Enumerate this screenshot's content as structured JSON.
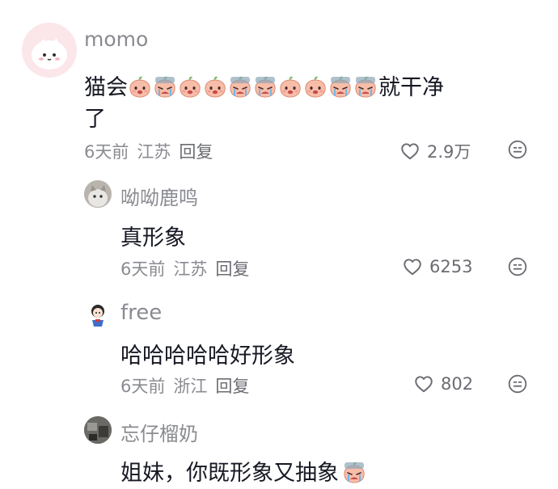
{
  "comments": [
    {
      "username": "momo",
      "text_before": "猫会",
      "text_after": "就干净",
      "text_line2": "了",
      "emoji_sequence": [
        "peach-face",
        "peach-cry",
        "peach-face",
        "peach-face",
        "peach-cry",
        "peach-cry",
        "peach-face",
        "peach-face",
        "peach-cry",
        "peach-cry"
      ],
      "time": "6天前",
      "location": "江苏",
      "reply": "回复",
      "likes": "2.9万"
    },
    {
      "username": "呦呦鹿鸣",
      "text": "真形象",
      "time": "6天前",
      "location": "江苏",
      "reply": "回复",
      "likes": "6253"
    },
    {
      "username": "free",
      "text": "哈哈哈哈哈好形象",
      "time": "6天前",
      "location": "浙江",
      "reply": "回复",
      "likes": "802"
    },
    {
      "username": "忘仔榴奶",
      "text": "姐妹，你既形象又抽象",
      "trailing_emoji": "peach-cry"
    }
  ],
  "colors": {
    "text": "#161823",
    "secondary": "#8a8b91",
    "peach": "#f6b7a4",
    "leaf": "#7bb86f"
  }
}
